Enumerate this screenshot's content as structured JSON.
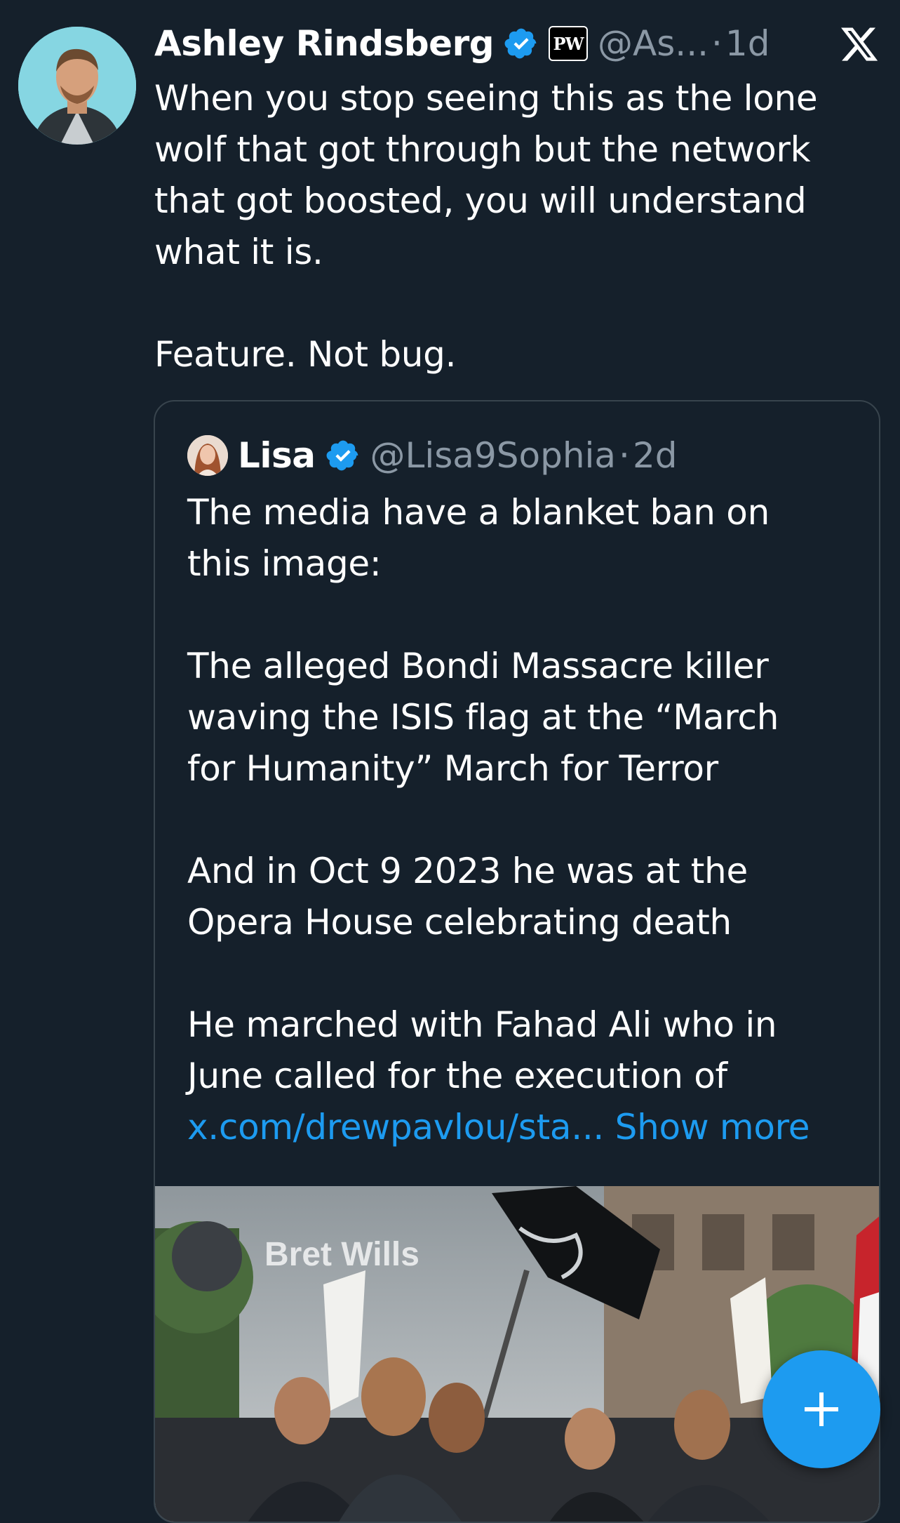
{
  "tweet": {
    "author_name": "Ashley Rindsberg",
    "verified_icon": "verified-badge-icon",
    "affiliation_badge": "PW",
    "handle": "@As...",
    "separator": "·",
    "time": "1d",
    "paragraphs": [
      "When you stop seeing this as the lone\nwolf that got through but the network\nthat got boosted, you will understand\nwhat it is.",
      "Feature. Not bug."
    ]
  },
  "quote": {
    "author_name": "Lisa",
    "verified_icon": "verified-badge-icon",
    "handle": "@Lisa9Sophia",
    "separator": "·",
    "time": "2d",
    "paragraphs": [
      "The media have a blanket ban on\nthis image:",
      "The alleged Bondi Massacre killer\nwaving the ISIS flag at the “March\nfor Humanity” March for Terror",
      "And in Oct 9 2023 he was at the\nOpera House celebrating death",
      "He marched with Fahad Ali who in\nJune called for the execution of"
    ],
    "link": "x.com/drewpavlou/sta...",
    "show_more": "Show more",
    "media": {
      "watermark": "Bret Wills"
    }
  },
  "colors": {
    "background": "#15202b",
    "accent": "#1d9bf0",
    "secondary_text": "#8b98a5",
    "border": "#38444d"
  },
  "icons": {
    "app_logo": "x-logo-icon",
    "compose": "plus-icon"
  }
}
